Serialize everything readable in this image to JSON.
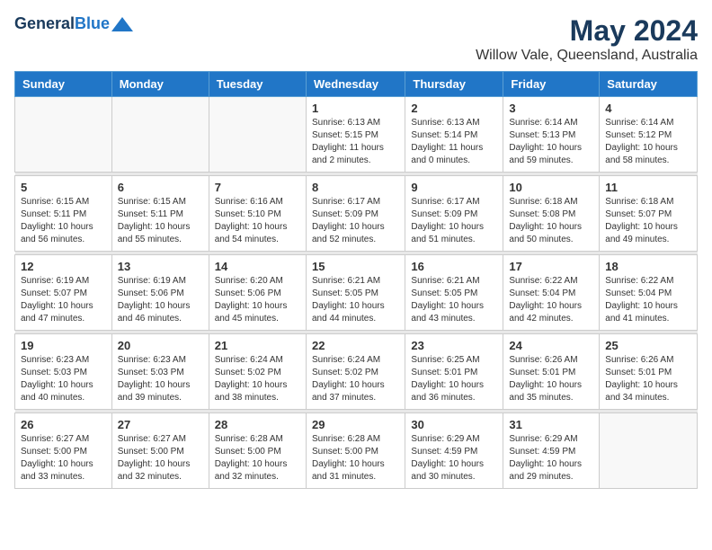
{
  "logo": {
    "line1": "General",
    "line2": "Blue"
  },
  "title": "May 2024",
  "subtitle": "Willow Vale, Queensland, Australia",
  "weekdays": [
    "Sunday",
    "Monday",
    "Tuesday",
    "Wednesday",
    "Thursday",
    "Friday",
    "Saturday"
  ],
  "weeks": [
    [
      {
        "day": "",
        "info": ""
      },
      {
        "day": "",
        "info": ""
      },
      {
        "day": "",
        "info": ""
      },
      {
        "day": "1",
        "info": "Sunrise: 6:13 AM\nSunset: 5:15 PM\nDaylight: 11 hours\nand 2 minutes."
      },
      {
        "day": "2",
        "info": "Sunrise: 6:13 AM\nSunset: 5:14 PM\nDaylight: 11 hours\nand 0 minutes."
      },
      {
        "day": "3",
        "info": "Sunrise: 6:14 AM\nSunset: 5:13 PM\nDaylight: 10 hours\nand 59 minutes."
      },
      {
        "day": "4",
        "info": "Sunrise: 6:14 AM\nSunset: 5:12 PM\nDaylight: 10 hours\nand 58 minutes."
      }
    ],
    [
      {
        "day": "5",
        "info": "Sunrise: 6:15 AM\nSunset: 5:11 PM\nDaylight: 10 hours\nand 56 minutes."
      },
      {
        "day": "6",
        "info": "Sunrise: 6:15 AM\nSunset: 5:11 PM\nDaylight: 10 hours\nand 55 minutes."
      },
      {
        "day": "7",
        "info": "Sunrise: 6:16 AM\nSunset: 5:10 PM\nDaylight: 10 hours\nand 54 minutes."
      },
      {
        "day": "8",
        "info": "Sunrise: 6:17 AM\nSunset: 5:09 PM\nDaylight: 10 hours\nand 52 minutes."
      },
      {
        "day": "9",
        "info": "Sunrise: 6:17 AM\nSunset: 5:09 PM\nDaylight: 10 hours\nand 51 minutes."
      },
      {
        "day": "10",
        "info": "Sunrise: 6:18 AM\nSunset: 5:08 PM\nDaylight: 10 hours\nand 50 minutes."
      },
      {
        "day": "11",
        "info": "Sunrise: 6:18 AM\nSunset: 5:07 PM\nDaylight: 10 hours\nand 49 minutes."
      }
    ],
    [
      {
        "day": "12",
        "info": "Sunrise: 6:19 AM\nSunset: 5:07 PM\nDaylight: 10 hours\nand 47 minutes."
      },
      {
        "day": "13",
        "info": "Sunrise: 6:19 AM\nSunset: 5:06 PM\nDaylight: 10 hours\nand 46 minutes."
      },
      {
        "day": "14",
        "info": "Sunrise: 6:20 AM\nSunset: 5:06 PM\nDaylight: 10 hours\nand 45 minutes."
      },
      {
        "day": "15",
        "info": "Sunrise: 6:21 AM\nSunset: 5:05 PM\nDaylight: 10 hours\nand 44 minutes."
      },
      {
        "day": "16",
        "info": "Sunrise: 6:21 AM\nSunset: 5:05 PM\nDaylight: 10 hours\nand 43 minutes."
      },
      {
        "day": "17",
        "info": "Sunrise: 6:22 AM\nSunset: 5:04 PM\nDaylight: 10 hours\nand 42 minutes."
      },
      {
        "day": "18",
        "info": "Sunrise: 6:22 AM\nSunset: 5:04 PM\nDaylight: 10 hours\nand 41 minutes."
      }
    ],
    [
      {
        "day": "19",
        "info": "Sunrise: 6:23 AM\nSunset: 5:03 PM\nDaylight: 10 hours\nand 40 minutes."
      },
      {
        "day": "20",
        "info": "Sunrise: 6:23 AM\nSunset: 5:03 PM\nDaylight: 10 hours\nand 39 minutes."
      },
      {
        "day": "21",
        "info": "Sunrise: 6:24 AM\nSunset: 5:02 PM\nDaylight: 10 hours\nand 38 minutes."
      },
      {
        "day": "22",
        "info": "Sunrise: 6:24 AM\nSunset: 5:02 PM\nDaylight: 10 hours\nand 37 minutes."
      },
      {
        "day": "23",
        "info": "Sunrise: 6:25 AM\nSunset: 5:01 PM\nDaylight: 10 hours\nand 36 minutes."
      },
      {
        "day": "24",
        "info": "Sunrise: 6:26 AM\nSunset: 5:01 PM\nDaylight: 10 hours\nand 35 minutes."
      },
      {
        "day": "25",
        "info": "Sunrise: 6:26 AM\nSunset: 5:01 PM\nDaylight: 10 hours\nand 34 minutes."
      }
    ],
    [
      {
        "day": "26",
        "info": "Sunrise: 6:27 AM\nSunset: 5:00 PM\nDaylight: 10 hours\nand 33 minutes."
      },
      {
        "day": "27",
        "info": "Sunrise: 6:27 AM\nSunset: 5:00 PM\nDaylight: 10 hours\nand 32 minutes."
      },
      {
        "day": "28",
        "info": "Sunrise: 6:28 AM\nSunset: 5:00 PM\nDaylight: 10 hours\nand 32 minutes."
      },
      {
        "day": "29",
        "info": "Sunrise: 6:28 AM\nSunset: 5:00 PM\nDaylight: 10 hours\nand 31 minutes."
      },
      {
        "day": "30",
        "info": "Sunrise: 6:29 AM\nSunset: 4:59 PM\nDaylight: 10 hours\nand 30 minutes."
      },
      {
        "day": "31",
        "info": "Sunrise: 6:29 AM\nSunset: 4:59 PM\nDaylight: 10 hours\nand 29 minutes."
      },
      {
        "day": "",
        "info": ""
      }
    ]
  ]
}
